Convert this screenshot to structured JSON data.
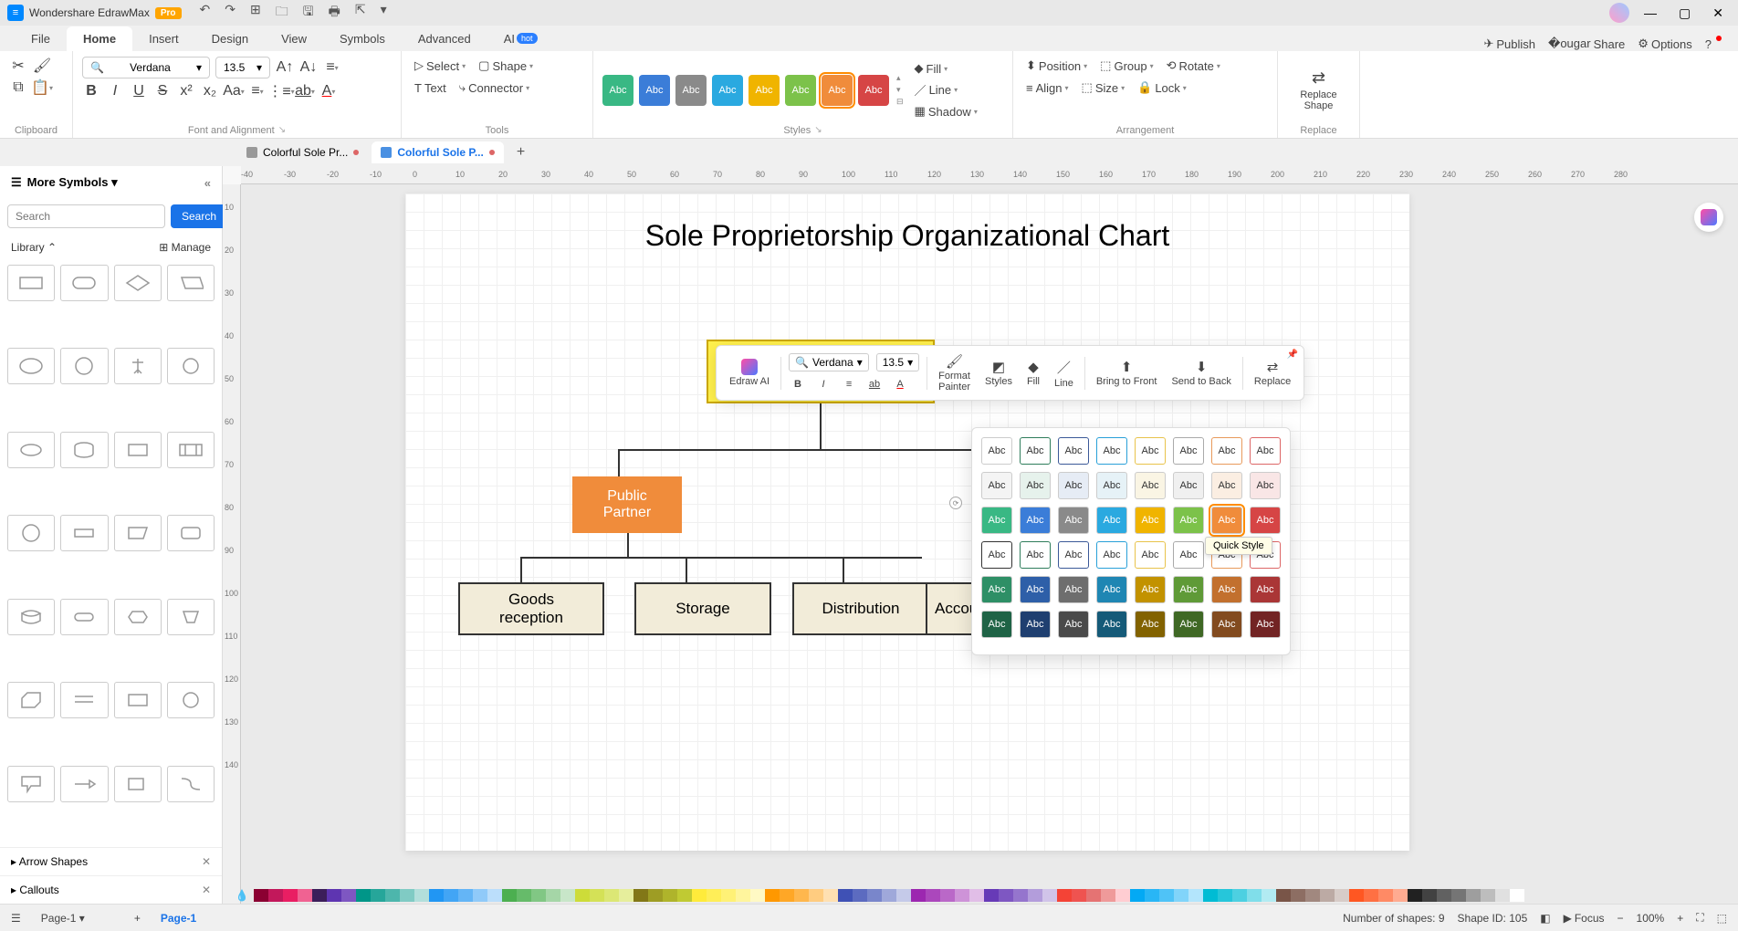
{
  "app": {
    "name": "Wondershare EdrawMax",
    "badge": "Pro"
  },
  "qat_icons": [
    "undo-icon",
    "redo-icon",
    "new-icon",
    "open-icon",
    "save-icon",
    "print-icon",
    "export-icon",
    "more-icon"
  ],
  "menu": {
    "tabs": [
      "File",
      "Home",
      "Insert",
      "Design",
      "View",
      "Symbols",
      "Advanced",
      "AI"
    ],
    "active": "Home",
    "right": {
      "publish": "Publish",
      "share": "Share",
      "options": "Options"
    }
  },
  "ribbon": {
    "clipboard_label": "Clipboard",
    "font": {
      "name": "Verdana",
      "size": "13.5"
    },
    "font_label": "Font and Alignment",
    "tools": {
      "select": "Select",
      "text": "Text",
      "shape": "Shape",
      "connector": "Connector",
      "label": "Tools"
    },
    "styles": {
      "swatches": [
        {
          "bg": "#39b884",
          "fg": "#fff"
        },
        {
          "bg": "#3b7dd8",
          "fg": "#fff"
        },
        {
          "bg": "#8a8a8a",
          "fg": "#fff"
        },
        {
          "bg": "#2aa9e0",
          "fg": "#fff"
        },
        {
          "bg": "#f0b400",
          "fg": "#fff"
        },
        {
          "bg": "#7cc24a",
          "fg": "#fff"
        },
        {
          "bg": "#f08c3b",
          "fg": "#fff",
          "sel": true
        },
        {
          "bg": "#d64545",
          "fg": "#fff"
        }
      ],
      "fill": "Fill",
      "line": "Line",
      "shadow": "Shadow",
      "label": "Styles"
    },
    "arrange": {
      "position": "Position",
      "align": "Align",
      "group": "Group",
      "size": "Size",
      "rotate": "Rotate",
      "lock": "Lock",
      "label": "Arrangement"
    },
    "replace": {
      "btn": "Replace\nShape",
      "label": "Replace"
    },
    "abc": "Abc"
  },
  "doctabs": [
    {
      "name": "Colorful Sole Pr...",
      "active": false,
      "modified": true
    },
    {
      "name": "Colorful Sole P...",
      "active": true,
      "modified": true
    }
  ],
  "leftpanel": {
    "title": "More Symbols",
    "search_placeholder": "Search",
    "search_btn": "Search",
    "library": "Library",
    "manage": "Manage",
    "sections": [
      "Arrow Shapes",
      "Callouts"
    ]
  },
  "ruler_h": [
    "-40",
    "-30",
    "-20",
    "-10",
    "0",
    "10",
    "20",
    "30",
    "40",
    "50",
    "60",
    "70",
    "80",
    "90",
    "100",
    "110",
    "120",
    "130",
    "140",
    "150",
    "160",
    "170",
    "180",
    "190",
    "200",
    "210",
    "220",
    "230",
    "240",
    "250",
    "260",
    "270",
    "280"
  ],
  "ruler_v": [
    "10",
    "20",
    "30",
    "40",
    "50",
    "60",
    "70",
    "80",
    "90",
    "100",
    "110",
    "120",
    "130",
    "140"
  ],
  "chart": {
    "title": "Sole Proprietorship Organizational Chart",
    "nodes": {
      "public_partner": "Public\nPartner",
      "goods": "Goods\nreception",
      "storage": "Storage",
      "distribution": "Distribution",
      "accounta": "Accounta"
    }
  },
  "minitoolbar": {
    "edraw_ai": "Edraw AI",
    "font": "Verdana",
    "size": "13.5",
    "format_painter": "Format\nPainter",
    "styles": "Styles",
    "fill": "Fill",
    "line": "Line",
    "bring_front": "Bring to Front",
    "send_back": "Send to Back",
    "replace": "Replace"
  },
  "quickstyle": {
    "tooltip": "Quick Style",
    "rows": [
      [
        {
          "bg": "#fff",
          "fg": "#333",
          "bd": "#ccc"
        },
        {
          "bg": "#fff",
          "fg": "#333",
          "bd": "#2e7d5b"
        },
        {
          "bg": "#fff",
          "fg": "#333",
          "bd": "#3b5998"
        },
        {
          "bg": "#fff",
          "fg": "#333",
          "bd": "#29a0d8"
        },
        {
          "bg": "#fff",
          "fg": "#333",
          "bd": "#e8c34b"
        },
        {
          "bg": "#fff",
          "fg": "#333",
          "bd": "#aaa"
        },
        {
          "bg": "#fff",
          "fg": "#333",
          "bd": "#e89a5b"
        },
        {
          "bg": "#fff",
          "fg": "#333",
          "bd": "#d66"
        }
      ],
      [
        {
          "bg": "#f4f4f4",
          "fg": "#333"
        },
        {
          "bg": "#e6f2ec",
          "fg": "#333"
        },
        {
          "bg": "#e6ecf5",
          "fg": "#333"
        },
        {
          "bg": "#e6f2f7",
          "fg": "#333"
        },
        {
          "bg": "#faf5e4",
          "fg": "#333"
        },
        {
          "bg": "#f0f0f0",
          "fg": "#333"
        },
        {
          "bg": "#fbeee2",
          "fg": "#333"
        },
        {
          "bg": "#f9e6e6",
          "fg": "#333"
        }
      ],
      [
        {
          "bg": "#39b884",
          "fg": "#fff"
        },
        {
          "bg": "#3b7dd8",
          "fg": "#fff"
        },
        {
          "bg": "#8a8a8a",
          "fg": "#fff"
        },
        {
          "bg": "#2aa9e0",
          "fg": "#fff"
        },
        {
          "bg": "#f0b400",
          "fg": "#fff"
        },
        {
          "bg": "#7cc24a",
          "fg": "#fff"
        },
        {
          "bg": "#f08c3b",
          "fg": "#fff",
          "sel": true
        },
        {
          "bg": "#d64545",
          "fg": "#fff"
        }
      ],
      [
        {
          "bg": "#fff",
          "fg": "#333",
          "bd": "#333"
        },
        {
          "bg": "#fff",
          "fg": "#333",
          "bd": "#2e7d5b"
        },
        {
          "bg": "#fff",
          "fg": "#333",
          "bd": "#3b5998"
        },
        {
          "bg": "#fff",
          "fg": "#333",
          "bd": "#29a0d8"
        },
        {
          "bg": "#fff",
          "fg": "#333",
          "bd": "#e8c34b"
        },
        {
          "bg": "#fff",
          "fg": "#333",
          "bd": "#aaa"
        },
        {
          "bg": "#fff",
          "fg": "#333",
          "bd": "#e89a5b"
        },
        {
          "bg": "#fff",
          "fg": "#333",
          "bd": "#d66"
        }
      ],
      [
        {
          "bg": "#2e8f66",
          "fg": "#fff"
        },
        {
          "bg": "#2e5fa8",
          "fg": "#fff"
        },
        {
          "bg": "#6e6e6e",
          "fg": "#fff"
        },
        {
          "bg": "#1f86b3",
          "fg": "#fff"
        },
        {
          "bg": "#c29200",
          "fg": "#fff"
        },
        {
          "bg": "#5f9a37",
          "fg": "#fff"
        },
        {
          "bg": "#c2702e",
          "fg": "#fff"
        },
        {
          "bg": "#aa3636",
          "fg": "#fff"
        }
      ],
      [
        {
          "bg": "#1f6346",
          "fg": "#fff"
        },
        {
          "bg": "#1f3f70",
          "fg": "#fff"
        },
        {
          "bg": "#4a4a4a",
          "fg": "#fff"
        },
        {
          "bg": "#155a78",
          "fg": "#fff"
        },
        {
          "bg": "#826200",
          "fg": "#fff"
        },
        {
          "bg": "#3f6825",
          "fg": "#fff"
        },
        {
          "bg": "#824b1f",
          "fg": "#fff"
        },
        {
          "bg": "#722424",
          "fg": "#fff"
        }
      ]
    ]
  },
  "colorbar": [
    "#8b0032",
    "#c2185b",
    "#e91e63",
    "#f06292",
    "#3c1e5a",
    "#5e35b1",
    "#7e57c2",
    "#009688",
    "#26a69a",
    "#4db6ac",
    "#80cbc4",
    "#b2dfdb",
    "#2196f3",
    "#42a5f5",
    "#64b5f6",
    "#90caf9",
    "#bbdefb",
    "#4caf50",
    "#66bb6a",
    "#81c784",
    "#a5d6a7",
    "#c8e6c9",
    "#cddc39",
    "#d4e157",
    "#dce775",
    "#e6ee9c",
    "#827717",
    "#9e9d24",
    "#afb42b",
    "#c0ca33",
    "#ffeb3b",
    "#ffee58",
    "#fff176",
    "#fff59d",
    "#fff9c4",
    "#ff9800",
    "#ffa726",
    "#ffb74d",
    "#ffcc80",
    "#ffe0b2",
    "#3f51b5",
    "#5c6bc0",
    "#7986cb",
    "#9fa8da",
    "#c5cae9",
    "#9c27b0",
    "#ab47bc",
    "#ba68c8",
    "#ce93d8",
    "#e1bee7",
    "#673ab7",
    "#7e57c2",
    "#9575cd",
    "#b39ddb",
    "#d1c4e9",
    "#f44336",
    "#ef5350",
    "#e57373",
    "#ef9a9a",
    "#ffcdd2",
    "#03a9f4",
    "#29b6f6",
    "#4fc3f7",
    "#81d4fa",
    "#b3e5fc",
    "#00bcd4",
    "#26c6da",
    "#4dd0e1",
    "#80deea",
    "#b2ebf2",
    "#795548",
    "#8d6e63",
    "#a1887f",
    "#bcaaa4",
    "#d7ccc8",
    "#ff5722",
    "#ff7043",
    "#ff8a65",
    "#ffab91",
    "#212121",
    "#424242",
    "#616161",
    "#757575",
    "#9e9e9e",
    "#bdbdbd",
    "#e0e0e0",
    "#ffffff"
  ],
  "status": {
    "page_sel": "Page-1",
    "page_active": "Page-1",
    "shapes": "Number of shapes: 9",
    "shape_id": "Shape ID: 105",
    "focus": "Focus",
    "zoom": "100%"
  }
}
